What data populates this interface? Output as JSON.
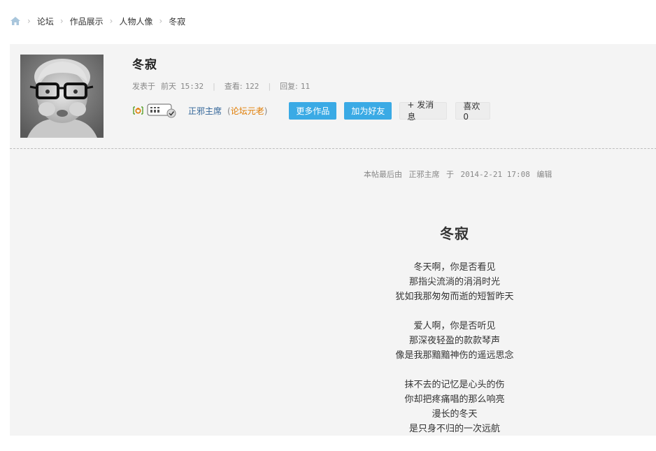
{
  "breadcrumb": {
    "items": [
      "论坛",
      "作品展示",
      "人物人像",
      "冬寂"
    ],
    "separator": "›"
  },
  "post": {
    "title": "冬寂",
    "posted_label": "发表于",
    "posted_time": "前天",
    "posted_clock": "15:32",
    "views_label": "查看:",
    "views": "122",
    "replies_label": "回复:",
    "replies": "11"
  },
  "user": {
    "name": "正邪主席",
    "role": "论坛元老",
    "online_icon": "online-icon",
    "medal_icon": "medal-icon"
  },
  "actions": {
    "more_works": "更多作品",
    "add_friend": "加为好友",
    "send_message": "+ 发消息",
    "like": "喜欢0"
  },
  "edited_note": {
    "prefix": "本帖最后由",
    "user": "正邪主席",
    "mid": "于",
    "datetime": "2014-2-21 17:08",
    "suffix": "编辑"
  },
  "poem": {
    "title": "冬寂",
    "stanzas": [
      [
        "冬天啊，你是否看见",
        "那指尖流淌的涓涓时光",
        "犹如我那匆匆而逝的短暂昨天"
      ],
      [
        "爱人啊，你是否听见",
        "那深夜轻盈的款款琴声",
        "像是我那黯黯神伤的遥远思念"
      ],
      [
        "抹不去的记忆是心头的伤",
        "你却把疼痛唱的那么响亮",
        "漫长的冬天",
        "是只身不归的一次远航"
      ]
    ]
  },
  "colors": {
    "accent": "#3aaae5",
    "link": "#336699",
    "role": "#e07b00",
    "card_bg": "#f4f4f4"
  }
}
